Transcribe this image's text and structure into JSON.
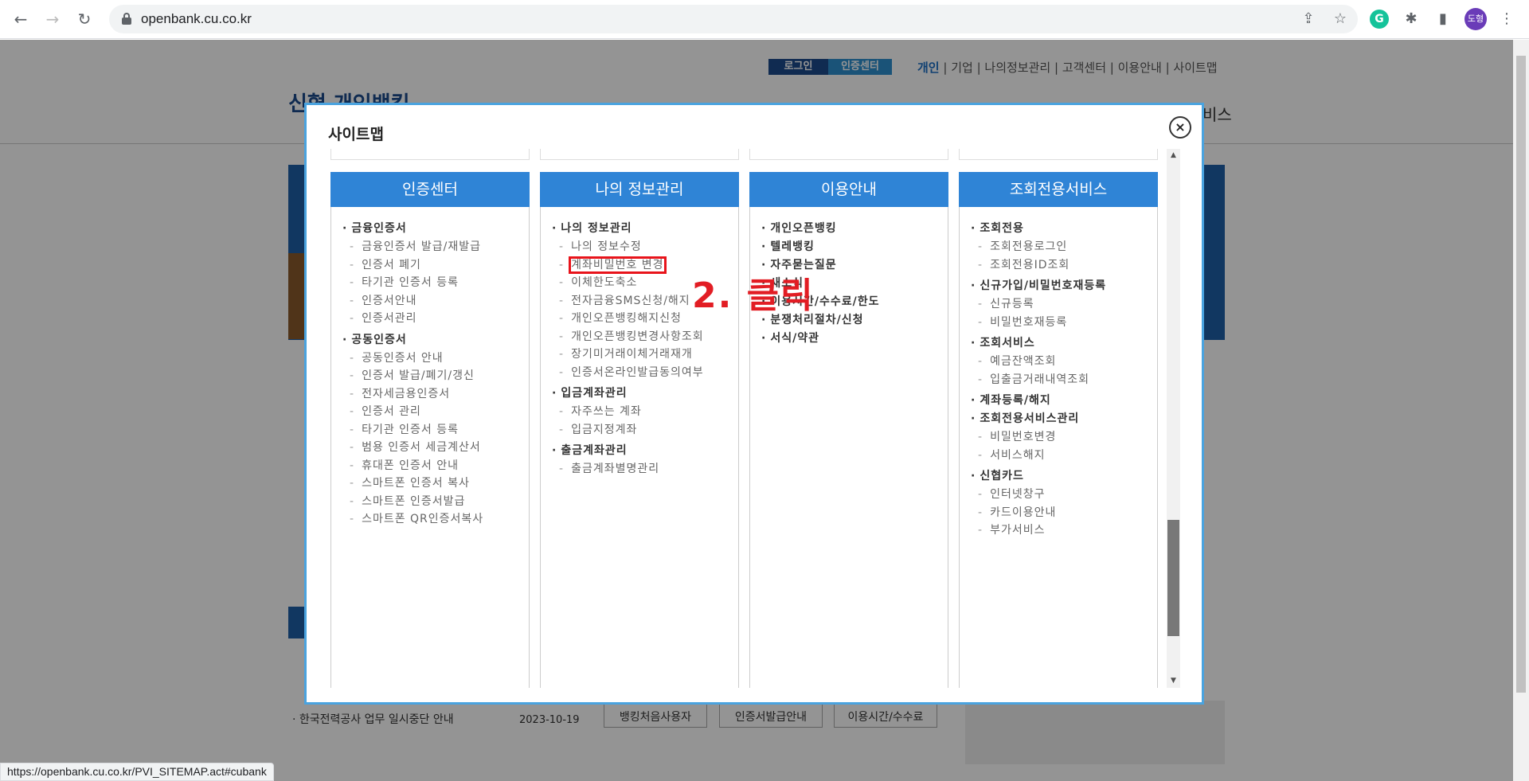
{
  "browser": {
    "url": "openbank.cu.co.kr",
    "profile_initials": "도형",
    "status_url": "https://openbank.cu.co.kr/PVI_SITEMAP.act#cubank"
  },
  "page": {
    "login_label": "로그인",
    "cert_label": "인증센터",
    "util_links": [
      "개인",
      "기업",
      "나의정보관리",
      "고객센터",
      "이용안내",
      "사이트맵"
    ],
    "logo_text": "신협 개인뱅킹",
    "gnb_tail": "비스",
    "notice_text": "한국전력공사 업무 일시중단 안내",
    "notice_date": "2023-10-19",
    "quick_buttons": [
      "뱅킹처음사용자",
      "인증서발급안내",
      "이용시간/수수료"
    ]
  },
  "modal": {
    "title": "사이트맵",
    "close_label": "×",
    "annotation": "2. 클릭",
    "columns": [
      {
        "header": "인증센터",
        "groups": [
          {
            "title": "금융인증서",
            "items": [
              "금융인증서 발급/재발급",
              "인증서 폐기",
              "타기관 인증서 등록",
              "인증서안내",
              "인증서관리"
            ]
          },
          {
            "title": "공동인증서",
            "items": [
              "공동인증서 안내",
              "인증서 발급/폐기/갱신",
              "전자세금용인증서",
              "인증서 관리",
              "타기관 인증서 등록",
              "범용 인증서 세금계산서",
              "휴대폰 인증서 안내",
              "스마트폰 인증서 복사",
              "스마트폰 인증서발급",
              "스마트폰 QR인증서복사"
            ]
          }
        ]
      },
      {
        "header": "나의 정보관리",
        "groups": [
          {
            "title": "나의 정보관리",
            "items": [
              "나의 정보수정",
              "계좌비밀번호 변경",
              "이체한도축소",
              "전자금융SMS신청/해지",
              "개인오픈뱅킹해지신청",
              "개인오픈뱅킹변경사항조회",
              "장기미거래이체거래재개",
              "인증서온라인발급동의여부"
            ]
          },
          {
            "title": "입금계좌관리",
            "items": [
              "자주쓰는 계좌",
              "입금지정계좌"
            ]
          },
          {
            "title": "출금계좌관리",
            "items": [
              "출금계좌별명관리"
            ]
          }
        ]
      },
      {
        "header": "이용안내",
        "groups": [
          {
            "title": "개인오픈뱅킹",
            "items": []
          },
          {
            "title": "텔레뱅킹",
            "items": []
          },
          {
            "title": "자주묻는질문",
            "items": []
          },
          {
            "title": "새소식",
            "items": []
          },
          {
            "title": "이용시간/수수료/한도",
            "items": []
          },
          {
            "title": "분쟁처리절차/신청",
            "items": []
          },
          {
            "title": "서식/약관",
            "items": []
          }
        ]
      },
      {
        "header": "조회전용서비스",
        "groups": [
          {
            "title": "조회전용",
            "items": [
              "조회전용로그인",
              "조회전용ID조회"
            ]
          },
          {
            "title": "신규가입/비밀번호재등록",
            "items": [
              "신규등록",
              "비밀번호재등록"
            ]
          },
          {
            "title": "조회서비스",
            "items": [
              "예금잔액조회",
              "입출금거래내역조회"
            ]
          },
          {
            "title": "계좌등록/해지",
            "items": []
          },
          {
            "title": "조회전용서비스관리",
            "items": [
              "비밀번호변경",
              "서비스해지"
            ]
          },
          {
            "title": "신협카드",
            "items": [
              "인터넷창구",
              "카드이용안내",
              "부가서비스"
            ]
          }
        ]
      }
    ]
  }
}
